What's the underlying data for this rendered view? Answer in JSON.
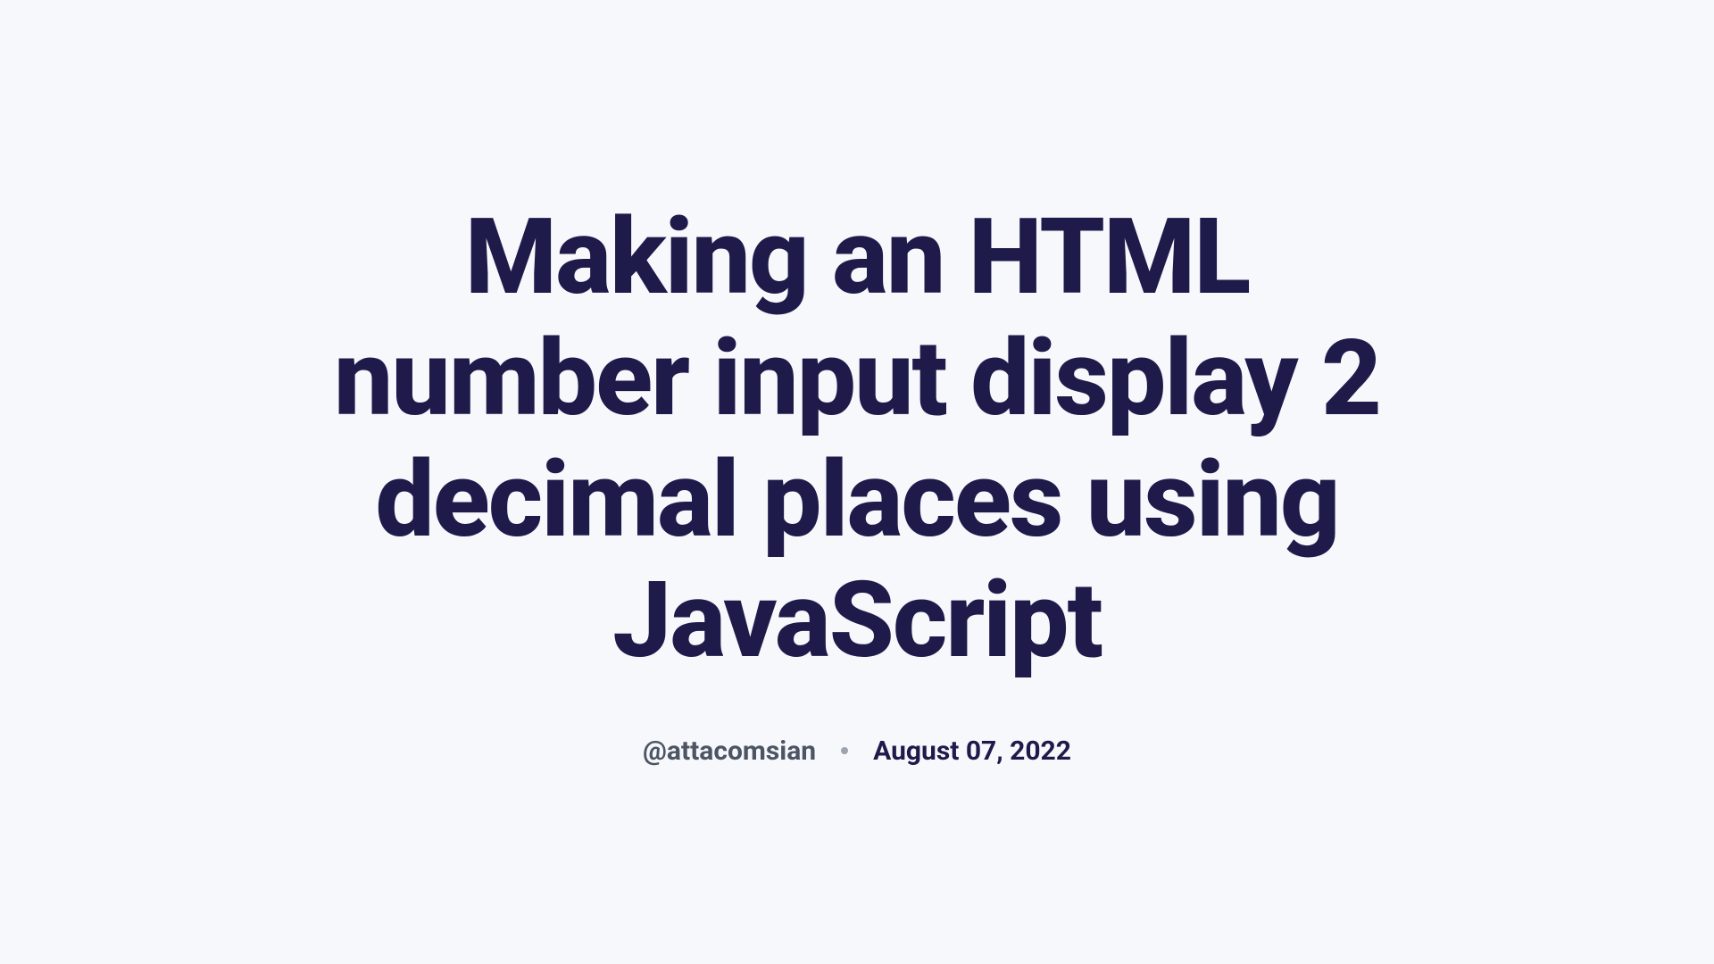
{
  "article": {
    "title": "Making an HTML number input display 2 decimal places using JavaScript",
    "author": "@attacomsian",
    "date": "August 07, 2022"
  }
}
